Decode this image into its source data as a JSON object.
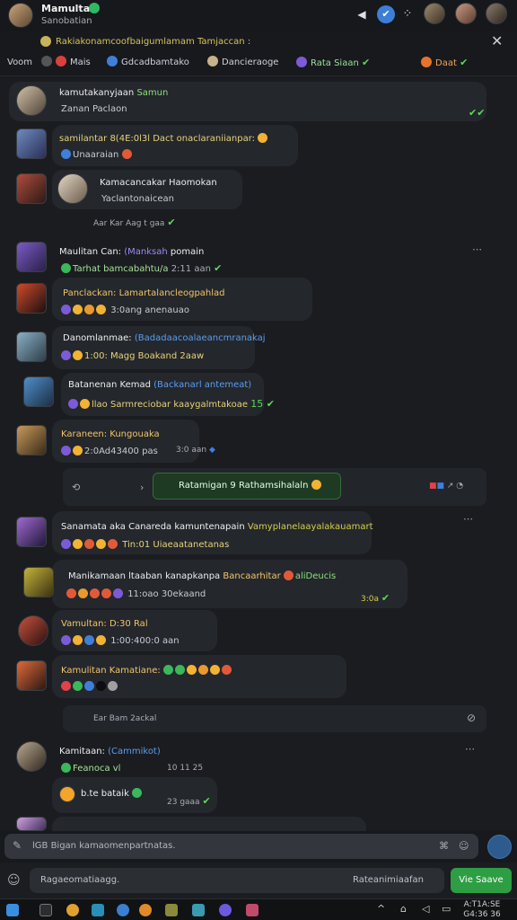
{
  "header": {
    "name": "Mamulta",
    "subtitle": "Sanobatian",
    "icons": [
      "speaker-icon",
      "verified-icon",
      "grid-icon"
    ]
  },
  "pinned": {
    "text": "Rakiakonamcoofbaigumlamam Tamjaccan :"
  },
  "filters": {
    "label": "Voom",
    "items": [
      {
        "label": "Mais",
        "color": "#d9413a"
      },
      {
        "label": "Gdcadbamtako",
        "color": "#3f7fd9"
      },
      {
        "label": "Dancieraoge",
        "color": "#c9b28a"
      },
      {
        "label": "Rata Siaan",
        "color": "#7c5bd6"
      },
      {
        "label": "Daat",
        "color": "#e5742a"
      }
    ]
  },
  "messages": [
    {
      "line1": "kamutakanyjaan",
      "tag": "Samun",
      "line2": "Zanan Paclaon"
    },
    {
      "line1": "samilantar 8(4E:0l3l Dact onaclaraniianpar:",
      "line2": "Unaaraian"
    },
    {
      "line1": "Kamacancakar Haomokan",
      "line2": "Yaclantonaicean"
    },
    {
      "line1": "Maulitan Can:",
      "tag": "(Manksah",
      "tag2": "pomain",
      "line2": "Tarhat bamcabahtu/a",
      "time": "2:11 aan"
    },
    {
      "line1": "Panclackan: Lamartalancleogpahlad",
      "line2": "3:0ang anenauao"
    },
    {
      "line1": "Danomlanmae:",
      "tag": "(Badadaacoalaeancmranakaj",
      "line2": "1:00: Magg Boakand 2aaw"
    },
    {
      "line1": "Batanenan Kemad",
      "tag": "(Backanarl antemeat)",
      "line2": "llao Sarmreciobar kaaygalmtakoae"
    },
    {
      "line1": "Karaneen: Kungouaka",
      "line2": "2:0Ad43400 pas",
      "time": "3:0 aan"
    },
    {
      "line1": "Sanamata aka Canareda kamuntenapain",
      "tag": "Vamyplanelaayalakauamart",
      "line2": "Tin:01 Uiaeaatanetanas"
    },
    {
      "line1": "Manikamaan ltaaban kanapkanpa",
      "tag": "Bancaarhitar",
      "tag2": "aliDeucis",
      "line2": "11:oao 30ekaand",
      "time": "3:0a"
    },
    {
      "line1": "Vamultan: D:30 Ral",
      "line2": "1:00:400:0 aan"
    },
    {
      "line1": "Kamulitan Kamatiane:",
      "line2": ""
    },
    {
      "line1": "Kamitaan:",
      "tag": "(Cammikot)",
      "line2": "Feanoca vl",
      "time": "10 11 25"
    },
    {
      "line1": "b.te bataik",
      "line2": "",
      "time": "23 gaaa"
    }
  ],
  "banner": {
    "text": "Ratamigan  9 Rathamsihalaln"
  },
  "meta": {
    "row1": "Aar     Kar    Aag t gaa",
    "row2": "Ear    Bam    2ackal"
  },
  "input": {
    "placeholder": "lGB Bigan kamaomenpartnatas."
  },
  "compose": {
    "placeholder": "Ragaeomatiaagg.",
    "right": "Rateanimiaafan",
    "button": "Vie Saave"
  },
  "taskbar": {
    "time": "A:T1A:SE",
    "date": "G4:36 36"
  }
}
